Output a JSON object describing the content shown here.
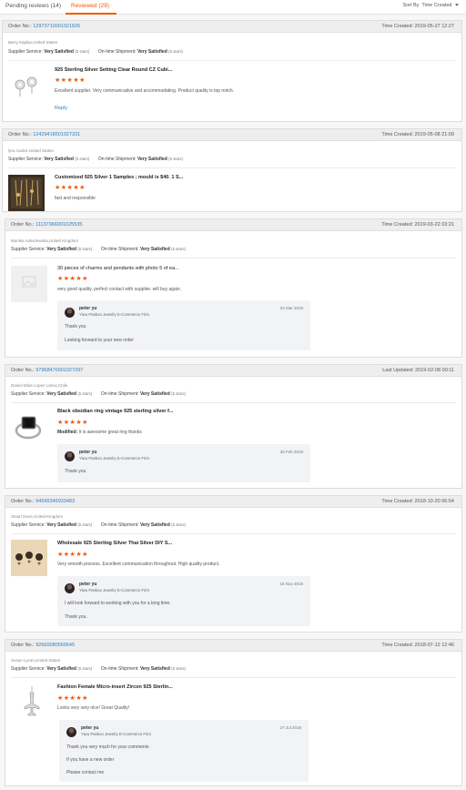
{
  "tabs": [
    {
      "label": "Pending reviews (14)"
    },
    {
      "label": "Reviewed (29)"
    }
  ],
  "sort": {
    "label": "Sort By",
    "value": "Time Created"
  },
  "labels": {
    "order_no": "Order No.:",
    "supplier_service": "Supplier Service:",
    "on_time_shipment": "On-time Shipment:",
    "reply": "Reply",
    "modified": "Modified:"
  },
  "reviews": [
    {
      "order_no": "12973710001021826",
      "time": "Time Created: 2019-05-27 12:27",
      "buyer": "Barry Kaplan,United States",
      "supplier_rating": "Very Satisfied",
      "supplier_stars": "(5 stars)",
      "shipment_rating": "Very Satisfied",
      "shipment_stars": "(5 stars)",
      "product": "925 Sterling Silver Setting Clear Round CZ Cubi...",
      "comment": "Excellent supplier. Very communicative and accommodating. Product quality is top notch.",
      "reply": "Reply"
    },
    {
      "order_no": "12429418501027331",
      "time": "Time Created: 2019-05-08 21:09",
      "buyer": "lyra roudre,United States",
      "supplier_rating": "Very Satisfied",
      "supplier_stars": "(5 stars)",
      "shipment_rating": "Very Satisfied",
      "shipment_stars": "(5 stars)",
      "product": "Customized 925 Silver 1 Samples ; mould is $40. 1 S...",
      "comment": "fast and responsible"
    },
    {
      "order_no": "11137966001025535",
      "time": "Time Created: 2019-03-22 03:21",
      "buyer": "Monika Adaszewska,United Kingdom",
      "supplier_rating": "Very Satisfied",
      "supplier_stars": "(5 stars)",
      "shipment_rating": "Very Satisfied",
      "shipment_stars": "(5 stars)",
      "product": "30 pieces of charms and pendants with photo 5 of ea...",
      "comment": "very good quality, perfect contact with supplier. will buy again.",
      "seller_reply": {
        "name": "peter yu",
        "firm": "Yiwu Pankoo Jewelry E-Commerce Firm",
        "date": "22 Mar 2019",
        "lines": [
          "Thank you",
          "Looking forward to your new order"
        ]
      }
    },
    {
      "order_no": "97968470001027297",
      "time": "Last Updated: 2019-02-08 00:11",
      "buyer": "Daniel Elias Lopez Lobos,Chile",
      "supplier_rating": "Very Satisfied",
      "supplier_stars": "(5 stars)",
      "shipment_rating": "Very Satisfied",
      "shipment_stars": "(5 stars)",
      "product": "Black obsidian ring vintage 925 sterling silver f...",
      "comment": "It is awesome great ring thanks",
      "seller_reply": {
        "name": "peter yu",
        "firm": "Yiwu Pankoo Jewelry E-Commerce Firm",
        "date": "26 Feb 2019",
        "lines": [
          "Thank you"
        ]
      }
    },
    {
      "order_no": "94596346933483",
      "time": "Time Created: 2018-10-20 06:54",
      "buyer": "Stuart Dove,United Kingdom",
      "supplier_rating": "Very Satisfied",
      "supplier_stars": "(5 stars)",
      "shipment_rating": "Very Satisfied",
      "shipment_stars": "(5 stars)",
      "product": "Wholesale 925 Sterling Silver Thai Silver DIY S...",
      "comment": "Very smooth process. Excellent communication throughout. High quality product.",
      "seller_reply": {
        "name": "peter yu",
        "firm": "Yiwu Pankoo Jewelry E-Commerce Firm",
        "date": "15 Nov 2018",
        "lines": [
          "I will look forward to working with you for a long time.",
          "Thank you."
        ]
      }
    },
    {
      "order_no": "92660080569645",
      "time": "Time Created: 2018-07-12 12:46",
      "buyer": "Susan Lycan,United States",
      "supplier_rating": "Very Satisfied",
      "supplier_stars": "(5 stars)",
      "shipment_rating": "Very Satisfied",
      "shipment_stars": "(5 stars)",
      "product": "Fashion Female Micro-insert Zircon 925 Sterlin...",
      "comment": "Looks very very nice!  Great Quality!",
      "seller_reply": {
        "name": "peter yu",
        "firm": "Yiwu Pankoo Jewelry E-Commerce Firm",
        "date": "27 Jul 2018",
        "lines": [
          "Thank you very much for your comments",
          "If you have a new order",
          "Please contact me"
        ]
      }
    }
  ],
  "stars": "★★★★★",
  "colors": {
    "accent": "#f05a00",
    "link": "#2d7fc3"
  }
}
